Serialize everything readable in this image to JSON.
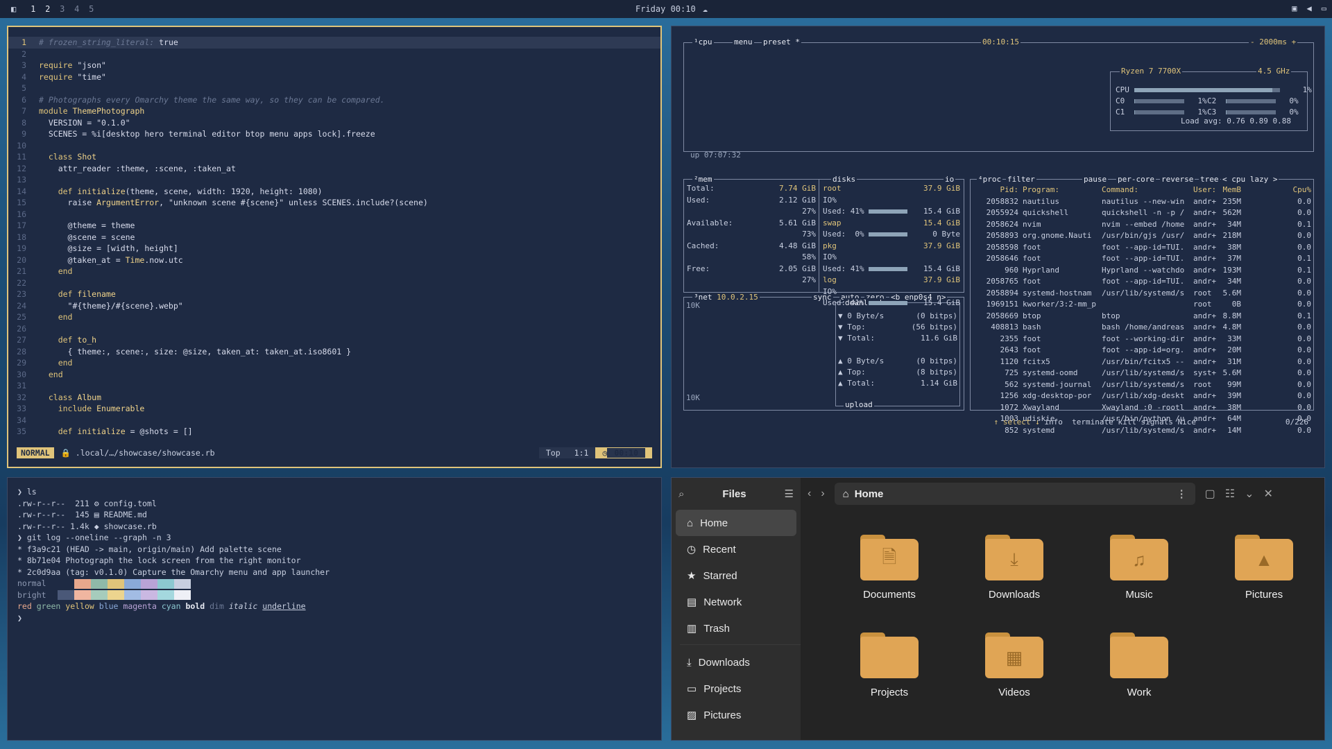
{
  "topbar": {
    "workspaces": [
      "1",
      "2",
      "3",
      "4",
      "5"
    ],
    "clock": "Friday 00:10"
  },
  "editor": {
    "lines": [
      {
        "n": "1",
        "parts": [
          [
            "cm",
            "# frozen_string_literal: "
          ],
          [
            "c",
            "true"
          ]
        ],
        "cur": true
      },
      {
        "n": "2",
        "parts": []
      },
      {
        "n": "3",
        "parts": [
          [
            "kw",
            "require "
          ],
          [
            "st",
            "\"json\""
          ]
        ]
      },
      {
        "n": "4",
        "parts": [
          [
            "kw",
            "require "
          ],
          [
            "st",
            "\"time\""
          ]
        ]
      },
      {
        "n": "5",
        "parts": []
      },
      {
        "n": "6",
        "parts": [
          [
            "cm",
            "# Photographs every Omarchy theme the same way, so they can be compared."
          ]
        ]
      },
      {
        "n": "7",
        "parts": [
          [
            "kw",
            "module "
          ],
          [
            "cn",
            "ThemePhotograph"
          ]
        ]
      },
      {
        "n": "8",
        "parts": [
          [
            "c",
            "  VERSION = "
          ],
          [
            "st",
            "\"0.1.0\""
          ]
        ]
      },
      {
        "n": "9",
        "parts": [
          [
            "c",
            "  SCENES = %i[desktop hero terminal editor btop menu apps lock].freeze"
          ]
        ]
      },
      {
        "n": "10",
        "parts": []
      },
      {
        "n": "11",
        "parts": [
          [
            "kw",
            "  class "
          ],
          [
            "cn",
            "Shot"
          ]
        ]
      },
      {
        "n": "12",
        "parts": [
          [
            "c",
            "    attr_reader :theme, :scene, :taken_at"
          ]
        ]
      },
      {
        "n": "13",
        "parts": []
      },
      {
        "n": "14",
        "parts": [
          [
            "kw",
            "    def "
          ],
          [
            "cn",
            "initialize"
          ],
          [
            "c",
            "(theme, scene, width: 1920, height: 1080)"
          ]
        ]
      },
      {
        "n": "15",
        "parts": [
          [
            "c",
            "      raise "
          ],
          [
            "cn",
            "ArgumentError"
          ],
          [
            "c",
            ", \"unknown scene #{scene}\" unless SCENES.include?(scene)"
          ]
        ]
      },
      {
        "n": "16",
        "parts": []
      },
      {
        "n": "17",
        "parts": [
          [
            "c",
            "      @theme = theme"
          ]
        ]
      },
      {
        "n": "18",
        "parts": [
          [
            "c",
            "      @scene = scene"
          ]
        ]
      },
      {
        "n": "19",
        "parts": [
          [
            "c",
            "      @size = [width, height]"
          ]
        ]
      },
      {
        "n": "20",
        "parts": [
          [
            "c",
            "      @taken_at = "
          ],
          [
            "cn",
            "Time"
          ],
          [
            "c",
            ".now.utc"
          ]
        ]
      },
      {
        "n": "21",
        "parts": [
          [
            "kw",
            "    end"
          ]
        ]
      },
      {
        "n": "22",
        "parts": []
      },
      {
        "n": "23",
        "parts": [
          [
            "kw",
            "    def "
          ],
          [
            "cn",
            "filename"
          ]
        ]
      },
      {
        "n": "24",
        "parts": [
          [
            "st",
            "      \"#{theme}/#{scene}.webp\""
          ]
        ]
      },
      {
        "n": "25",
        "parts": [
          [
            "kw",
            "    end"
          ]
        ]
      },
      {
        "n": "26",
        "parts": []
      },
      {
        "n": "27",
        "parts": [
          [
            "kw",
            "    def "
          ],
          [
            "cn",
            "to_h"
          ]
        ]
      },
      {
        "n": "28",
        "parts": [
          [
            "c",
            "      { theme:, scene:, size: @size, taken_at: taken_at.iso8601 }"
          ]
        ]
      },
      {
        "n": "29",
        "parts": [
          [
            "kw",
            "    end"
          ]
        ]
      },
      {
        "n": "30",
        "parts": [
          [
            "kw",
            "  end"
          ]
        ]
      },
      {
        "n": "31",
        "parts": []
      },
      {
        "n": "32",
        "parts": [
          [
            "kw",
            "  class "
          ],
          [
            "cn",
            "Album"
          ]
        ]
      },
      {
        "n": "33",
        "parts": [
          [
            "kw",
            "    include "
          ],
          [
            "cn",
            "Enumerable"
          ]
        ]
      },
      {
        "n": "34",
        "parts": []
      },
      {
        "n": "35",
        "parts": [
          [
            "kw",
            "    def "
          ],
          [
            "cn",
            "initialize"
          ],
          [
            "c",
            " = @shots = []"
          ]
        ]
      }
    ],
    "status": {
      "mode": "NORMAL",
      "file": ".local/…/showcase/showcase.rb",
      "pos": "Top",
      "cursor": "1:1",
      "time": "00:10"
    }
  },
  "btop": {
    "cpu": {
      "title": "cpu",
      "menu": "menu",
      "preset": "preset *",
      "time": "00:10:15",
      "interval": "- 2000ms +",
      "model": "Ryzen 7 7700X",
      "freq": "4.5 GHz",
      "uptime": "up 07:07:32",
      "loadavg": "Load avg: 0.76 0.89 0.88",
      "cores": [
        {
          "name": "CPU",
          "pct": "1%",
          "fill": 0.95
        },
        {
          "name": "C0",
          "pct": "1%",
          "fill": 0.02
        },
        {
          "name": "C2",
          "pct": "0%",
          "fill": 0.0
        },
        {
          "name": "C1",
          "pct": "1%",
          "fill": 0.02
        },
        {
          "name": "C3",
          "pct": "0%",
          "fill": 0.0
        }
      ]
    },
    "mem": {
      "title": "mem",
      "rows": [
        [
          "Total:",
          "7.74 GiB"
        ],
        [
          "Used:",
          "2.12 GiB"
        ],
        [
          "",
          "27%"
        ],
        [
          "Available:",
          "5.61 GiB"
        ],
        [
          "",
          "73%"
        ],
        [
          "Cached:",
          "4.48 GiB"
        ],
        [
          "",
          "58%"
        ],
        [
          "Free:",
          "2.05 GiB"
        ],
        [
          "",
          "27%"
        ]
      ]
    },
    "disks": {
      "title": "disks",
      "io": "io",
      "items": [
        {
          "name": "root",
          "size": "37.9 GiB",
          "io": "IO%",
          "used": "Used: 41%",
          "usedv": "15.4 GiB"
        },
        {
          "name": "swap",
          "size": "15.4 GiB",
          "io": "",
          "used": "Used:  0%",
          "usedv": "0 Byte"
        },
        {
          "name": "pkg",
          "size": "37.9 GiB",
          "io": "IO%",
          "used": "Used: 41%",
          "usedv": "15.4 GiB"
        },
        {
          "name": "log",
          "size": "37.9 GiB",
          "io": "IO%",
          "used": "Used: 41%",
          "usedv": "15.4 GiB"
        }
      ]
    },
    "net": {
      "title": "net",
      "ip": "10.0.2.15",
      "sync": "sync",
      "auto": "auto",
      "zero": "zero",
      "iface": "<b enp0s4 n>",
      "scale": "10K",
      "download": {
        "label": "download",
        "rate": "0 Byte/s",
        "ratebits": "(0 bitps)",
        "top": "Top:",
        "topbits": "(56 bitps)",
        "total": "Total:",
        "totalv": "11.6 GiB"
      },
      "upload": {
        "label": "upload",
        "rate": "0 Byte/s",
        "ratebits": "(0 bitps)",
        "top": "Top:",
        "topbits": "(8 bitps)",
        "total": "Total:",
        "totalv": "1.14 GiB"
      }
    },
    "proc": {
      "title": "proc",
      "filter": "filter",
      "pause": "pause",
      "percore": "per-core",
      "reverse": "reverse",
      "tree": "tree",
      "sort": "< cpu lazy >",
      "header": [
        "Pid:",
        "Program:",
        "Command:",
        "User:",
        "MemB",
        "Cpu%"
      ],
      "rows": [
        [
          "2058832",
          "nautilus",
          "nautilus --new-win",
          "andr+",
          "235M",
          "0.0"
        ],
        [
          "2055924",
          "quickshell",
          "quickshell -n -p /",
          "andr+",
          "562M",
          "0.0"
        ],
        [
          "2058624",
          "nvim",
          "nvim --embed /home",
          "andr+",
          "34M",
          "0.1"
        ],
        [
          "2058893",
          "org.gnome.Nauti",
          "/usr/bin/gjs /usr/",
          "andr+",
          "218M",
          "0.0"
        ],
        [
          "2058598",
          "foot",
          "foot --app-id=TUI.",
          "andr+",
          "38M",
          "0.0"
        ],
        [
          "2058646",
          "foot",
          "foot --app-id=TUI.",
          "andr+",
          "37M",
          "0.1"
        ],
        [
          "960",
          "Hyprland",
          "Hyprland --watchdo",
          "andr+",
          "193M",
          "0.1"
        ],
        [
          "2058765",
          "foot",
          "foot --app-id=TUI.",
          "andr+",
          "34M",
          "0.0"
        ],
        [
          "2058894",
          "systemd-hostnam",
          "/usr/lib/systemd/s",
          "root",
          "5.6M",
          "0.0"
        ],
        [
          "1969151",
          "kworker/3:2-mm_p",
          "",
          "root",
          "0B",
          "0.0"
        ],
        [
          "2058669",
          "btop",
          "btop",
          "andr+",
          "8.8M",
          "0.1"
        ],
        [
          "408813",
          "bash",
          "bash /home/andreas",
          "andr+",
          "4.8M",
          "0.0"
        ],
        [
          "2355",
          "foot",
          "foot --working-dir",
          "andr+",
          "33M",
          "0.0"
        ],
        [
          "2643",
          "foot",
          "foot --app-id=org.",
          "andr+",
          "20M",
          "0.0"
        ],
        [
          "1120",
          "fcitx5",
          "/usr/bin/fcitx5 --",
          "andr+",
          "31M",
          "0.0"
        ],
        [
          "725",
          "systemd-oomd",
          "/usr/lib/systemd/s",
          "syst+",
          "5.6M",
          "0.0"
        ],
        [
          "562",
          "systemd-journal",
          "/usr/lib/systemd/s",
          "root",
          "99M",
          "0.0"
        ],
        [
          "1256",
          "xdg-desktop-por",
          "/usr/lib/xdg-deskt",
          "andr+",
          "39M",
          "0.0"
        ],
        [
          "1072",
          "Xwayland",
          "Xwayland :0 -rootl",
          "andr+",
          "38M",
          "0.0"
        ],
        [
          "1003",
          "udiskie",
          "/usr/bin/python /u",
          "andr+",
          "64M",
          "0.0"
        ],
        [
          "852",
          "systemd",
          "/usr/lib/systemd/s",
          "andr+",
          "14M",
          "0.0"
        ]
      ],
      "footer": {
        "select": "↑ select ↓",
        "info": "info",
        "terminate": "terminate",
        "kill": "kill",
        "signals": "signals",
        "nice": "Nice",
        "count": "0/226"
      }
    }
  },
  "terminal": {
    "lines": [
      "❯ ls",
      ".rw-r--r--  211 ⚙ config.toml",
      ".rw-r--r--  145 ▤ README.md",
      ".rw-r--r-- 1.4k ◆ showcase.rb",
      "❯ git log --oneline --graph -n 3",
      "* f3a9c21 (HEAD -> main, origin/main) Add palette scene",
      "* 8b71e04 Photograph the lock screen from the right monitor",
      "* 2c0d9aa (tag: v0.1.0) Capture the Omarchy menu and app launcher"
    ],
    "palette": {
      "normal_label": "normal",
      "bright_label": "bright",
      "normal": [
        "#1e2a43",
        "#e8a88c",
        "#8fb9a8",
        "#e0c47a",
        "#8aa9d8",
        "#b9a3d6",
        "#8cc8d0",
        "#c8cfe0"
      ],
      "bright": [
        "#4a5878",
        "#f0b6a0",
        "#a6ccbc",
        "#ecd48e",
        "#a2bce4",
        "#cab8e2",
        "#a4d8de",
        "#eef0f6"
      ]
    },
    "styles_line": [
      "red",
      "green",
      "yellow",
      "blue",
      "magenta",
      "cyan",
      "bold",
      "dim",
      "italic",
      "underline"
    ],
    "prompt": "❯"
  },
  "files": {
    "title": "Files",
    "location": "Home",
    "sidebar": [
      {
        "label": "Home",
        "icon": "home-icon",
        "sel": true
      },
      {
        "label": "Recent",
        "icon": "clock-icon"
      },
      {
        "label": "Starred",
        "icon": "star-icon"
      },
      {
        "label": "Network",
        "icon": "network-icon"
      },
      {
        "label": "Trash",
        "icon": "trash-icon"
      }
    ],
    "bookmarks": [
      {
        "label": "Downloads",
        "icon": "download-icon"
      },
      {
        "label": "Projects",
        "icon": "folder-icon"
      },
      {
        "label": "Pictures",
        "icon": "picture-icon"
      }
    ],
    "folders": [
      {
        "label": "Documents",
        "glyph": "🗎"
      },
      {
        "label": "Downloads",
        "glyph": "⤓"
      },
      {
        "label": "Music",
        "glyph": "♫"
      },
      {
        "label": "Pictures",
        "glyph": "▲"
      },
      {
        "label": "Projects",
        "glyph": ""
      },
      {
        "label": "Videos",
        "glyph": "▦"
      },
      {
        "label": "Work",
        "glyph": ""
      }
    ]
  }
}
